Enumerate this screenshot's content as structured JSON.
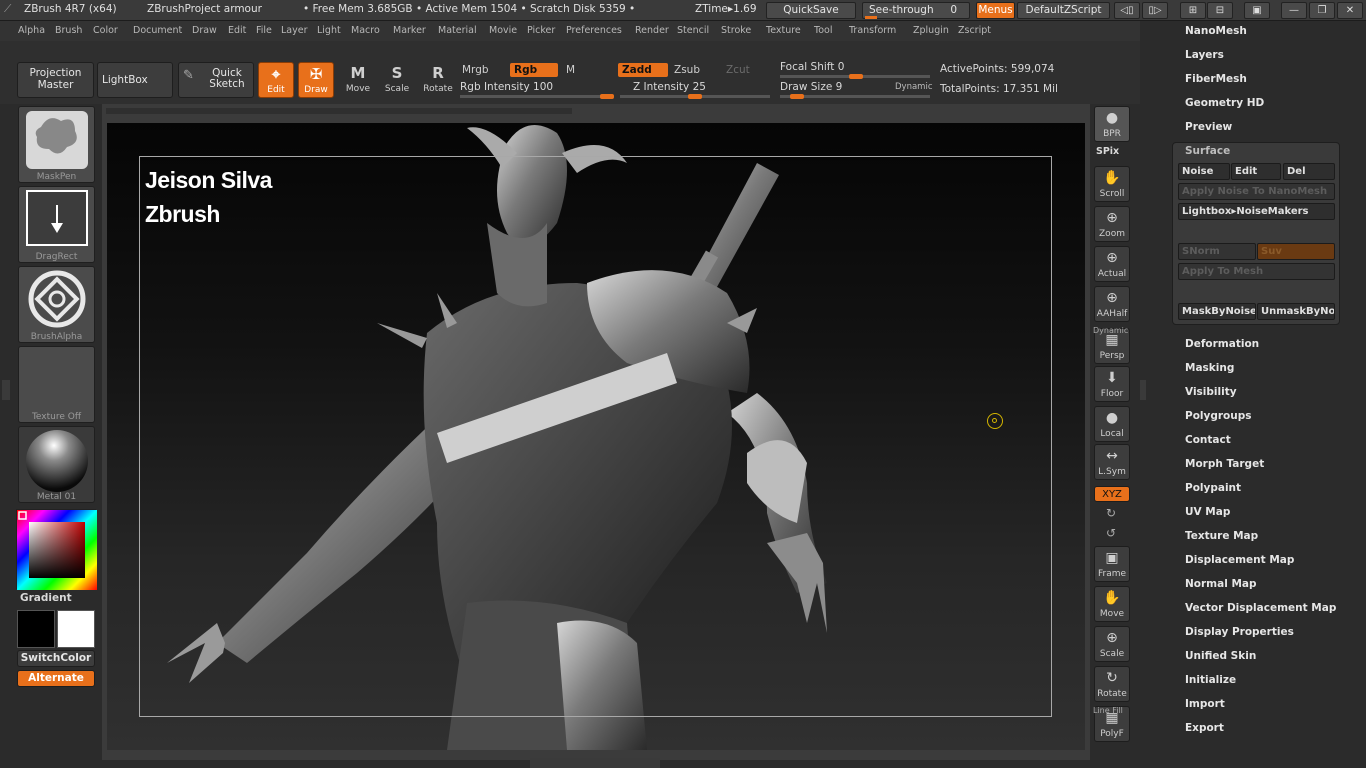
{
  "titlebar": {
    "app": "ZBrush 4R7 (x64)",
    "project": "ZBrushProject armour",
    "stats": "• Free Mem 3.685GB • Active Mem 1504 • Scratch Disk 5359 •",
    "ztime": "ZTime▸1.69",
    "quicksave": "QuickSave",
    "seethrough": "See-through",
    "seethrough_value": "0",
    "menus": "Menus",
    "defaultzscript": "DefaultZScript"
  },
  "menubar": [
    "Alpha",
    "Brush",
    "Color",
    "Document",
    "Draw",
    "Edit",
    "File",
    "Layer",
    "Light",
    "Macro",
    "Marker",
    "Material",
    "Movie",
    "Picker",
    "Preferences",
    "Render",
    "Stencil",
    "Stroke",
    "Texture",
    "Tool",
    "Transform",
    "Zplugin",
    "Zscript"
  ],
  "shelf": {
    "projection_master": [
      "Projection",
      "Master"
    ],
    "lightbox": "LightBox",
    "quick_sketch": [
      "Quick",
      "Sketch"
    ],
    "tools": [
      {
        "icon": "⌖",
        "label": "Edit",
        "active": true
      },
      {
        "icon": "✠",
        "label": "Draw",
        "active": true
      },
      {
        "icon": "M",
        "label": "Move",
        "active": false
      },
      {
        "icon": "S",
        "label": "Scale",
        "active": false
      },
      {
        "icon": "R",
        "label": "Rotate",
        "active": false
      }
    ],
    "mrgb": "Mrgb",
    "rgb": "Rgb",
    "m": "M",
    "zadd": "Zadd",
    "zsub": "Zsub",
    "zcut": "Zcut",
    "rgb_intensity_label": "Rgb Intensity",
    "rgb_intensity": "100",
    "z_intensity_label": "Z Intensity",
    "z_intensity": "25",
    "focal_shift_label": "Focal Shift",
    "focal_shift": "0",
    "draw_size_label": "Draw Size",
    "draw_size": "9",
    "dynamic": "Dynamic",
    "active_points_label": "ActivePoints:",
    "active_points": "599,074",
    "total_points_label": "TotalPoints:",
    "total_points": "17.351 Mil"
  },
  "lefttray": {
    "brush": "MaskPen",
    "stroke": "DragRect",
    "alpha": "BrushAlpha",
    "texture": "Texture Off",
    "material": "Metal 01",
    "gradient": "Gradient",
    "switchcolor": "SwitchColor",
    "alternate": "Alternate"
  },
  "canvas": {
    "watermark_line1": "Jeison Silva",
    "watermark_line2": "Zbrush"
  },
  "righttray": [
    {
      "label": "BPR",
      "icon": "●"
    },
    {
      "label": "SPix",
      "icon": ""
    },
    {
      "label": "Scroll",
      "icon": "✋"
    },
    {
      "label": "Zoom",
      "icon": "⊕"
    },
    {
      "label": "Actual",
      "icon": "⊕"
    },
    {
      "label": "AAHalf",
      "icon": "⊕"
    },
    {
      "label": "Persp",
      "icon": "▦"
    },
    {
      "label": "Floor",
      "icon": "⬇"
    },
    {
      "label": "Local",
      "icon": "●"
    },
    {
      "label": "L.Sym",
      "icon": "↔"
    },
    {
      "label": "XYZ",
      "icon": ""
    },
    {
      "label": "Frame",
      "icon": "▣"
    },
    {
      "label": "Move",
      "icon": "✋"
    },
    {
      "label": "Scale",
      "icon": "⊕"
    },
    {
      "label": "Rotate",
      "icon": "↻"
    },
    {
      "label": "PolyF",
      "icon": "▦"
    }
  ],
  "righttray_extra": {
    "dynamic": "Dynamic",
    "linefill": "Line Fill"
  },
  "palette": {
    "top_items": [
      "NanoMesh",
      "Layers",
      "FiberMesh",
      "Geometry HD",
      "Preview"
    ],
    "surface": {
      "title": "Surface",
      "noise": "Noise",
      "edit": "Edit",
      "del": "Del",
      "apply_noise": "Apply Noise To NanoMesh",
      "lightbox": "Lightbox▸NoiseMakers",
      "snorm": "SNorm",
      "suv": "Suv",
      "apply_mesh": "Apply To Mesh",
      "maskbynoise": "MaskByNoise",
      "unmaskbynoise": "UnmaskByNo"
    },
    "bottom_items": [
      "Deformation",
      "Masking",
      "Visibility",
      "Polygroups",
      "Contact",
      "Morph Target",
      "Polypaint",
      "UV Map",
      "Texture Map",
      "Displacement Map",
      "Normal Map",
      "Vector Displacement Map",
      "Display Properties",
      "Unified Skin",
      "Initialize",
      "Import",
      "Export"
    ]
  },
  "colors": {
    "accent": "#e8701b",
    "panel": "#2b2b2b",
    "button": "#3d3d3d"
  }
}
